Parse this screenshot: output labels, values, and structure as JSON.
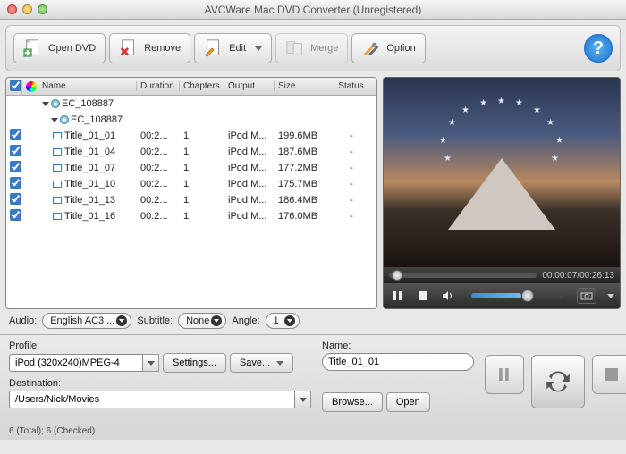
{
  "window": {
    "title": "AVCWare Mac DVD Converter (Unregistered)"
  },
  "toolbar": {
    "open": "Open DVD",
    "remove": "Remove",
    "edit": "Edit",
    "merge": "Merge",
    "option": "Option"
  },
  "columns": {
    "name": "Name",
    "duration": "Duration",
    "chapters": "Chapters",
    "output": "Output",
    "size": "Size",
    "status": "Status"
  },
  "disc": {
    "root": "EC_108887",
    "sub": "EC_108887"
  },
  "rows": [
    {
      "name": "Title_01_01",
      "dur": "00:2...",
      "chap": "1",
      "out": "iPod M...",
      "size": "199.6MB",
      "stat": "-"
    },
    {
      "name": "Title_01_04",
      "dur": "00:2...",
      "chap": "1",
      "out": "iPod M...",
      "size": "187.6MB",
      "stat": "-"
    },
    {
      "name": "Title_01_07",
      "dur": "00:2...",
      "chap": "1",
      "out": "iPod M...",
      "size": "177.2MB",
      "stat": "-"
    },
    {
      "name": "Title_01_10",
      "dur": "00:2...",
      "chap": "1",
      "out": "iPod M...",
      "size": "175.7MB",
      "stat": "-"
    },
    {
      "name": "Title_01_13",
      "dur": "00:2...",
      "chap": "1",
      "out": "iPod M...",
      "size": "186.4MB",
      "stat": "-"
    },
    {
      "name": "Title_01_16",
      "dur": "00:2...",
      "chap": "1",
      "out": "iPod M...",
      "size": "176.0MB",
      "stat": "-"
    }
  ],
  "playback": {
    "time": "00:00:07/00:26:13"
  },
  "audio": {
    "label": "Audio:",
    "value": "English AC3 ..."
  },
  "subtitle": {
    "label": "Subtitle:",
    "value": "None"
  },
  "angle": {
    "label": "Angle:",
    "value": "1"
  },
  "profile": {
    "label": "Profile:",
    "value": "iPod (320x240)MPEG-4",
    "settings": "Settings...",
    "save": "Save..."
  },
  "name": {
    "label": "Name:",
    "value": "Title_01_01"
  },
  "destination": {
    "label": "Destination:",
    "value": "/Users/Nick/Movies",
    "browse": "Browse...",
    "open": "Open"
  },
  "status": "6 (Total); 6 (Checked)"
}
